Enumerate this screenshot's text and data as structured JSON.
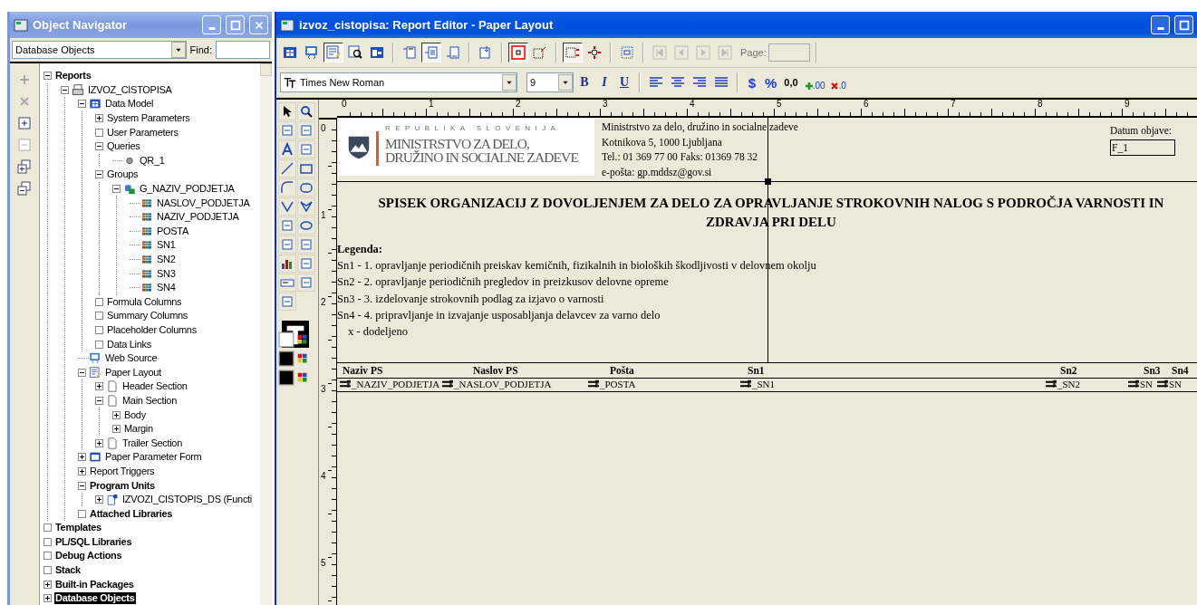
{
  "navigator": {
    "title": "Object Navigator",
    "view": "Database Objects",
    "find_label": "Find:",
    "tree": [
      {
        "label": "Reports",
        "kind": "category",
        "expanded": true,
        "selected": false,
        "children": [
          {
            "label": "IZVOZ_CISTOPISA",
            "kind": "report",
            "expanded": true,
            "selected": false,
            "children": [
              {
                "label": "Data Model",
                "kind": "data-model",
                "expanded": true,
                "selected": false,
                "children": [
                  {
                    "label": "System Parameters",
                    "kind": "folder",
                    "expanded": false,
                    "selected": false
                  },
                  {
                    "label": "User Parameters",
                    "kind": "folder",
                    "empty": true,
                    "selected": false
                  },
                  {
                    "label": "Queries",
                    "kind": "folder",
                    "expanded": true,
                    "selected": false,
                    "children": [
                      {
                        "label": "QR_1",
                        "kind": "query",
                        "selected": false
                      }
                    ]
                  },
                  {
                    "label": "Groups",
                    "kind": "folder",
                    "expanded": true,
                    "selected": false,
                    "children": [
                      {
                        "label": "G_NAZIV_PODJETJA",
                        "kind": "group",
                        "expanded": true,
                        "selected": false,
                        "children": [
                          {
                            "label": "NASLOV_PODJETJA",
                            "kind": "column",
                            "selected": false
                          },
                          {
                            "label": "NAZIV_PODJETJA",
                            "kind": "column",
                            "selected": false
                          },
                          {
                            "label": "POSTA",
                            "kind": "column",
                            "selected": false
                          },
                          {
                            "label": "SN1",
                            "kind": "column",
                            "selected": false
                          },
                          {
                            "label": "SN2",
                            "kind": "column",
                            "selected": false
                          },
                          {
                            "label": "SN3",
                            "kind": "column",
                            "selected": false
                          },
                          {
                            "label": "SN4",
                            "kind": "column",
                            "selected": false
                          }
                        ]
                      }
                    ]
                  },
                  {
                    "label": "Formula Columns",
                    "kind": "folder",
                    "empty": true,
                    "selected": false
                  },
                  {
                    "label": "Summary Columns",
                    "kind": "folder",
                    "empty": true,
                    "selected": false
                  },
                  {
                    "label": "Placeholder Columns",
                    "kind": "folder",
                    "empty": true,
                    "selected": false
                  },
                  {
                    "label": "Data Links",
                    "kind": "folder",
                    "empty": true,
                    "selected": false
                  }
                ]
              },
              {
                "label": "Web Source",
                "kind": "web-source",
                "selected": false
              },
              {
                "label": "Paper Layout",
                "kind": "paper-layout",
                "expanded": true,
                "selected": false,
                "children": [
                  {
                    "label": "Header Section",
                    "kind": "section",
                    "expanded": false,
                    "selected": false
                  },
                  {
                    "label": "Main Section",
                    "kind": "section",
                    "expanded": true,
                    "selected": false,
                    "children": [
                      {
                        "label": "Body",
                        "kind": "folder",
                        "expanded": false,
                        "selected": false
                      },
                      {
                        "label": "Margin",
                        "kind": "folder",
                        "expanded": false,
                        "selected": false
                      }
                    ]
                  },
                  {
                    "label": "Trailer Section",
                    "kind": "section",
                    "expanded": false,
                    "selected": false
                  }
                ]
              },
              {
                "label": "Paper Parameter Form",
                "kind": "form",
                "expanded": false,
                "selected": false
              },
              {
                "label": "Report Triggers",
                "kind": "folder",
                "expanded": false,
                "selected": false
              },
              {
                "label": "Program Units",
                "kind": "category",
                "expanded": true,
                "selected": false,
                "children": [
                  {
                    "label": "IZVOZI_CISTOPIS_DS (Functi",
                    "kind": "program-unit",
                    "expanded": false,
                    "selected": false
                  }
                ]
              },
              {
                "label": "Attached Libraries",
                "kind": "category",
                "empty": true,
                "selected": false
              }
            ]
          }
        ]
      },
      {
        "label": "Templates",
        "kind": "category",
        "empty": true,
        "selected": false
      },
      {
        "label": "PL/SQL Libraries",
        "kind": "category",
        "empty": true,
        "selected": false
      },
      {
        "label": "Debug Actions",
        "kind": "category",
        "empty": true,
        "selected": false
      },
      {
        "label": "Stack",
        "kind": "category",
        "empty": true,
        "selected": false
      },
      {
        "label": "Built-in Packages",
        "kind": "category",
        "expanded": false,
        "selected": false
      },
      {
        "label": "Database Objects",
        "kind": "category",
        "expanded": false,
        "selected": true
      }
    ]
  },
  "editor": {
    "title": "izvoz_cistopisa: Report Editor - Paper Layout",
    "toolbar": [
      {
        "kind": "data-model",
        "selected": false,
        "disabled": false
      },
      {
        "kind": "web-source",
        "selected": false,
        "disabled": false
      },
      {
        "kind": "paper-layout",
        "selected": true,
        "disabled": false
      },
      {
        "kind": "paper-design",
        "selected": false,
        "disabled": false
      },
      {
        "kind": "parameter-form",
        "selected": false,
        "disabled": false
      },
      {
        "kind": "header-section",
        "selected": false,
        "disabled": false
      },
      {
        "kind": "main-section",
        "selected": true,
        "disabled": false
      },
      {
        "kind": "trailer-section",
        "selected": false,
        "disabled": false
      },
      {
        "kind": "body-margin",
        "selected": false,
        "disabled": false
      },
      {
        "kind": "confine",
        "selected": true,
        "disabled": false
      },
      {
        "kind": "flex",
        "selected": false,
        "disabled": false
      },
      {
        "kind": "select-parent",
        "selected": true,
        "disabled": false
      },
      {
        "kind": "move-handles",
        "selected": false,
        "disabled": false
      },
      {
        "kind": "frame-select",
        "selected": false,
        "disabled": false
      },
      {
        "kind": "first-page",
        "selected": false,
        "disabled": true
      },
      {
        "kind": "previous-page",
        "selected": false,
        "disabled": true
      },
      {
        "kind": "next-page",
        "selected": false,
        "disabled": true
      },
      {
        "kind": "last-page",
        "selected": false,
        "disabled": true
      }
    ],
    "page_label": "Page:",
    "format": {
      "font": "Times New Roman",
      "size": "9",
      "style_buttons": [
        "B",
        "I",
        "U"
      ],
      "number_buttons": [
        "$",
        "%",
        "0,0"
      ],
      "decimal_buttons": [
        ".00",
        ".0"
      ]
    },
    "rulers": {
      "horizontal": [
        "0",
        "1",
        "2",
        "3",
        "4",
        "5",
        "6",
        "7",
        "8",
        "9"
      ],
      "vertical": [
        "0",
        "1",
        "2",
        "3",
        "4",
        "5"
      ]
    },
    "report": {
      "logo": [
        "REPUBLIKA SLOVENIJA",
        "MINISTRSTVO ZA DELO,",
        "DRUŽINO IN SOCIALNE ZADEVE"
      ],
      "address": [
        "Ministrstvo za delo, družino in socialne zadeve",
        "Kotnikova 5, 1000 Ljubljana",
        "Tel.: 01 369 77 00    Faks: 01369 78 32",
        "e-pošta: gp.mddsz@gov.si"
      ],
      "date_label": "Datum objave:",
      "date_field": "F_1",
      "title": "SPISEK ORGANIZACIJ Z DOVOLJENJEM ZA DELO ZA OPRAVLJANJE STROKOVNIH NALOG S PODROČJA VARNOSTI IN ZDRAVJA PRI DELU",
      "legend_title": "Legenda:",
      "legend": [
        "Sn1 - 1. opravljanje periodičnih preiskav kemičnih, fizikalnih in bioloških škodljivosti v delovnem okolju",
        "Sn2 - 2. opravljanje periodičnih pregledov in preizkusov delovne opreme",
        "Sn3 - 3. izdelovanje strokovnih podlag za izjavo o varnosti",
        "Sn4 - 4. pripravljanje in izvajanje usposabljanja delavcev za varno delo"
      ],
      "legend_note": "x - dodeljeno",
      "columns": [
        {
          "heading": "Naziv PS",
          "field": "_NAZIV_PODJETJA"
        },
        {
          "heading": "Naslov PS",
          "field": "_NASLOV_PODJETJA"
        },
        {
          "heading": "Pošta",
          "field": "_POSTA"
        },
        {
          "heading": "Sn1",
          "field": "_SN1"
        },
        {
          "heading": "Sn2",
          "field": "_SN2"
        },
        {
          "heading": "Sn3",
          "field": "SN"
        },
        {
          "heading": "Sn4",
          "field": "SN"
        }
      ]
    }
  }
}
